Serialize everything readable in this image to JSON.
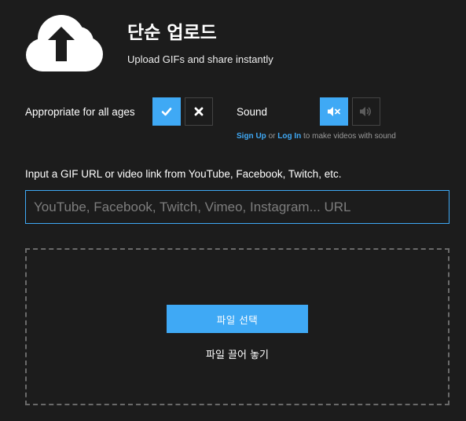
{
  "header": {
    "title": "단순 업로드",
    "subtitle": "Upload GIFs and share instantly",
    "logo_icon": "cloud-upload-icon"
  },
  "rating": {
    "label": "Appropriate for all ages",
    "yes_icon": "checkmark-icon",
    "no_icon": "x-icon",
    "selected": "yes"
  },
  "sound": {
    "label": "Sound",
    "muted_icon": "speaker-muted-icon",
    "on_icon": "speaker-icon",
    "selected": "muted",
    "note": {
      "signup": "Sign Up",
      "or": "or",
      "login": "Log In",
      "suffix": "to make videos with sound"
    }
  },
  "url": {
    "label": "Input a GIF URL or video link from YouTube, Facebook, Twitch, etc.",
    "value": "",
    "placeholder": "YouTube, Facebook, Twitch, Vimeo, Instagram... URL"
  },
  "dropzone": {
    "choose_button": "파일 선택",
    "drop_text": "파일 끌어 놓기"
  },
  "colors": {
    "accent": "#3fa9f5",
    "background": "#1c1c1c",
    "text": "#ffffff",
    "muted_text": "#9a9a9a"
  }
}
